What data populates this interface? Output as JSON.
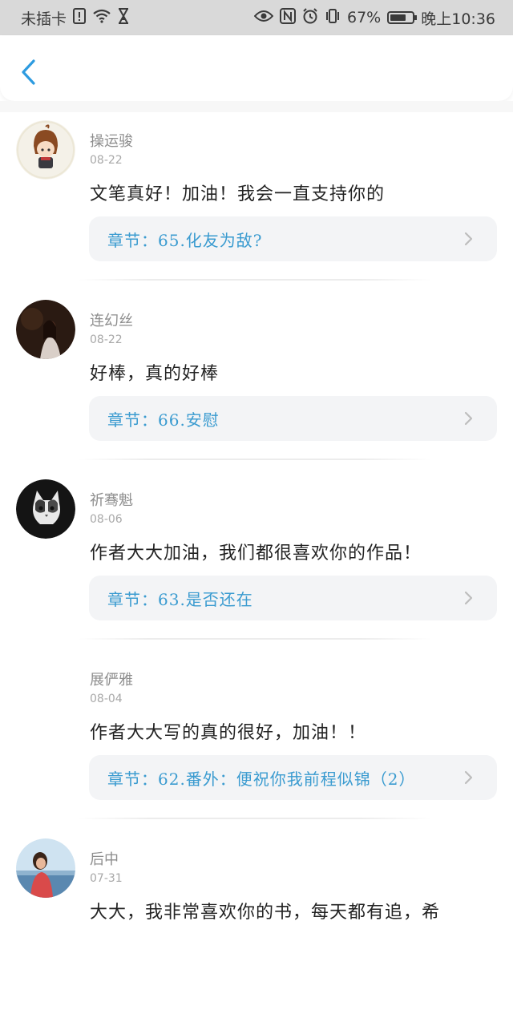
{
  "status_bar": {
    "carrier": "未插卡",
    "battery": "67%",
    "time": "晚上10:36",
    "icons": [
      "sim-alert-icon",
      "wifi-icon",
      "hourglass-icon",
      "eye-icon",
      "nfc-icon",
      "alarm-icon",
      "vibrate-icon",
      "battery-icon"
    ]
  },
  "nav": {
    "back_icon": "back-chevron-icon",
    "accent": "#2d9be0"
  },
  "theme": {
    "chapter_color": "#3a9bd0",
    "chapter_bg": "#f3f4f6"
  },
  "comments": [
    {
      "name": "操运骏",
      "date": "08-22",
      "text": "文笔真好！加油！我会一直支持你的",
      "chapter_label": "章节：",
      "chapter_title": "65.化友为敌?",
      "avatar": "anime-avatar"
    },
    {
      "name": "连幻丝",
      "date": "08-22",
      "text": "好棒，真的好棒",
      "chapter_label": "章节：",
      "chapter_title": "66.安慰",
      "avatar": "dark-photo-avatar"
    },
    {
      "name": "祈骞魁",
      "date": "08-06",
      "text": "作者大大加油，我们都很喜欢你的作品！",
      "chapter_label": "章节：",
      "chapter_title": "63.是否还在",
      "avatar": "cat-avatar"
    },
    {
      "name": "展俨雅",
      "date": "08-04",
      "text": "作者大大写的真的很好，加油！！",
      "chapter_label": "章节：",
      "chapter_title": "62.番外：便祝你我前程似锦（2）",
      "avatar": ""
    },
    {
      "name": "后中",
      "date": "07-31",
      "text": "大大，我非常喜欢你的书，每天都有追，希",
      "chapter_label": "",
      "chapter_title": "",
      "avatar": "seaside-photo-avatar"
    }
  ]
}
